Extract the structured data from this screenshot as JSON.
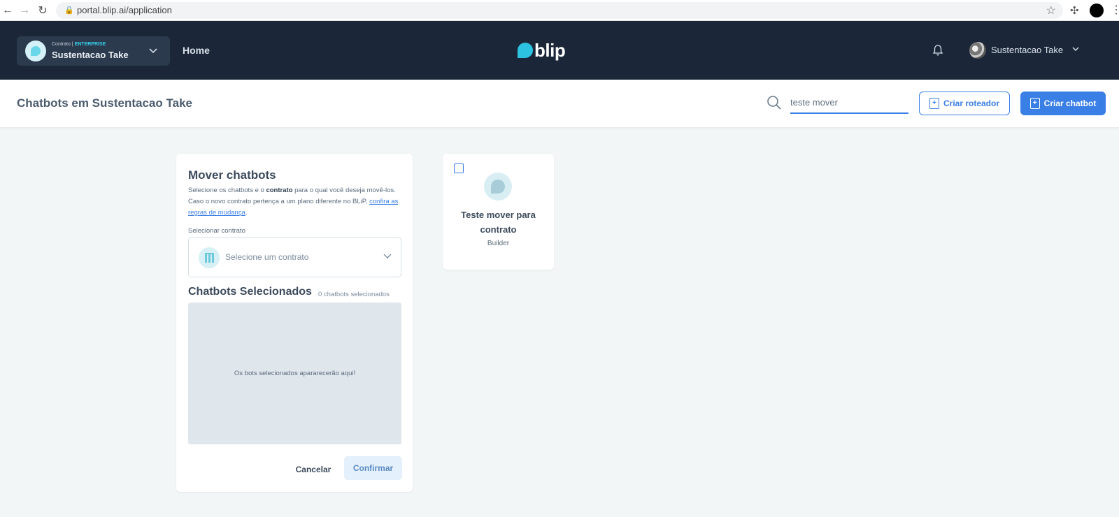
{
  "browser": {
    "url": "portal.blip.ai/application"
  },
  "topbar": {
    "contract_prefix": "Contrato |",
    "contract_plan": "ENTERPRISE",
    "contract_name": "Sustentacao Take",
    "home_label": "Home",
    "logo_text": "blip",
    "user_name": "Sustentacao Take"
  },
  "subheader": {
    "title": "Chatbots em Sustentacao Take",
    "search_value": "teste mover",
    "create_router_label": "Criar roteador",
    "create_chatbot_label": "Criar chatbot"
  },
  "move_panel": {
    "title": "Mover chatbots",
    "desc_part1": "Selecione os chatbots e o ",
    "desc_bold": "contrato",
    "desc_part2": " para o qual você deseja movê-los. Caso o novo contrato pertença a um plano diferente no BLiP, ",
    "desc_link": "confira as regras de mudança",
    "desc_end": ".",
    "select_label": "Selecionar contrato",
    "select_placeholder": "Selecione um contrato",
    "selected_title": "Chatbots Selecionados",
    "selected_count": "0 chatbots selecionados",
    "empty_text": "Os bots selecionados apararecerão aqui!",
    "cancel_label": "Cancelar",
    "confirm_label": "Confirmar"
  },
  "chatbot_card": {
    "name": "Teste mover para contrato",
    "type": "Builder"
  },
  "colors": {
    "navbar": "#1b2638",
    "accent": "#3a7fe6",
    "brand_cyan": "#2cc3e0",
    "page_bg": "#f3f6f7"
  }
}
